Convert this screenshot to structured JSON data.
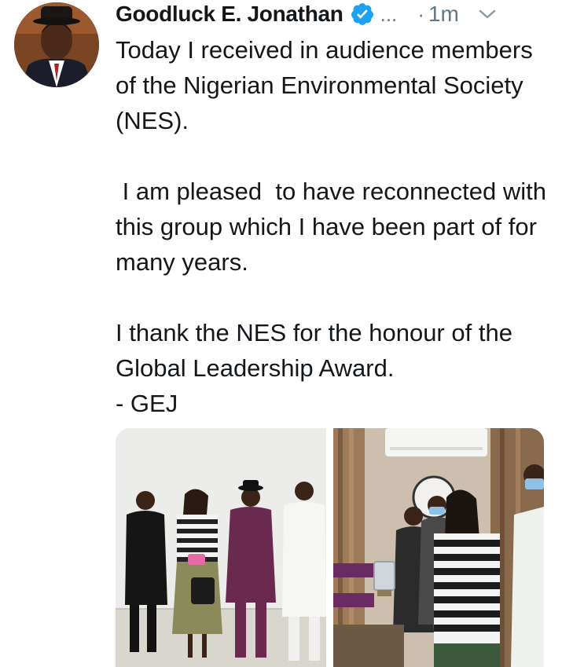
{
  "tweet": {
    "author_name": "Goodluck E. Jonathan",
    "ellipsis": "...",
    "separator": "·",
    "time": "1m",
    "paragraphs": [
      "Today I received in audience members of the Nigerian Environmental Society (NES).",
      " I am pleased  to have reconnected with this group which I have been part of for many years.",
      "I thank the NES for the honour of the Global Leadership Award.\n- GEJ"
    ]
  },
  "colors": {
    "verified": "#1da1f2",
    "muted": "#657786",
    "text": "#14171a"
  },
  "icons": {
    "verified": "verified-badge-icon",
    "menu": "chevron-down-icon"
  }
}
